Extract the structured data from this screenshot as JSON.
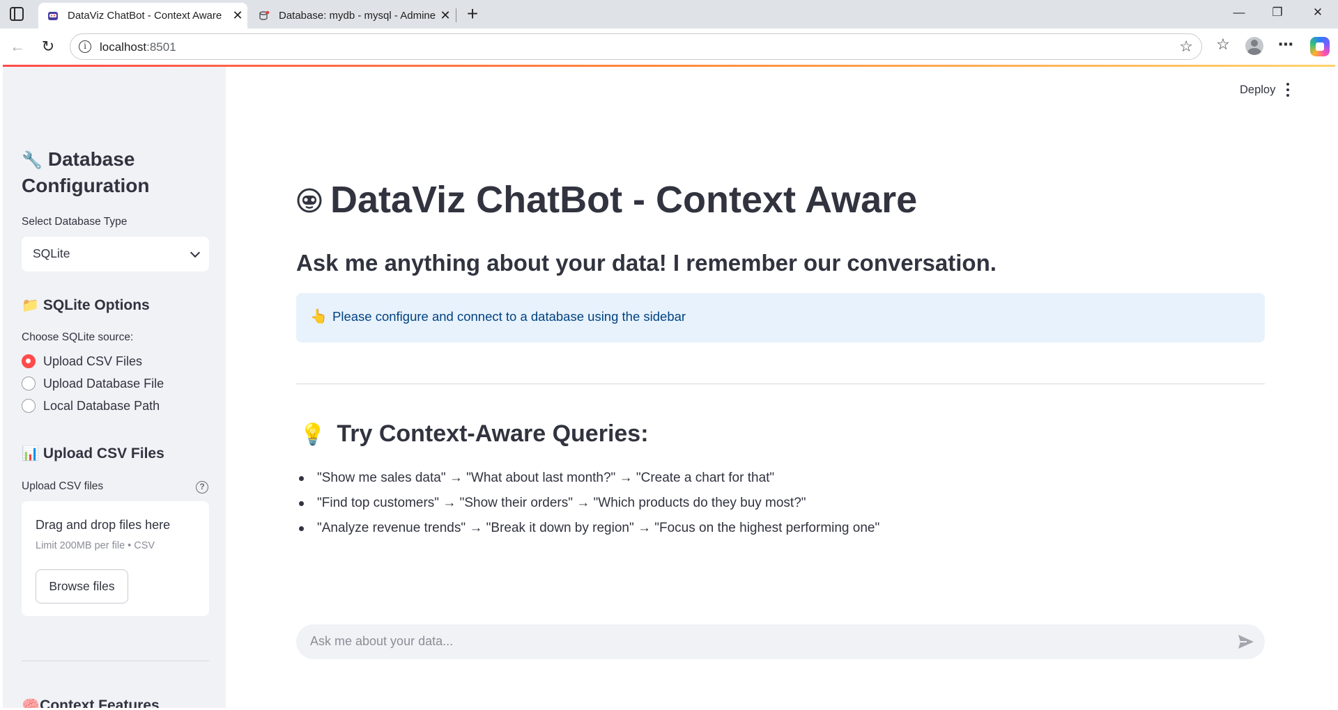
{
  "browser": {
    "tabs": [
      {
        "title": "DataViz ChatBot - Context Aware",
        "active": true
      },
      {
        "title": "Database: mydb - mysql - Adminer",
        "active": false
      }
    ],
    "url_host": "localhost",
    "url_port": ":8501"
  },
  "header": {
    "deploy_label": "Deploy"
  },
  "sidebar": {
    "title": "Database Configuration",
    "title_icon": "wrench",
    "db_type_label": "Select Database Type",
    "db_type_value": "SQLite",
    "sqlite_options_heading": "SQLite Options",
    "sqlite_options_icon": "folder",
    "source_label": "Choose SQLite source:",
    "source_options": [
      {
        "label": "Upload CSV Files",
        "checked": true
      },
      {
        "label": "Upload Database File",
        "checked": false
      },
      {
        "label": "Local Database Path",
        "checked": false
      }
    ],
    "upload_heading": "Upload CSV Files",
    "upload_icon": "bar-chart",
    "upload_label": "Upload CSV files",
    "drag_text": "Drag and drop files here",
    "limit_text": "Limit 200MB per file • CSV",
    "browse_label": "Browse files",
    "next_heading": "Context Features"
  },
  "main": {
    "title": "DataViz ChatBot - Context Aware",
    "subtitle": "Ask me anything about your data! I remember our conversation.",
    "info_message": "Please configure and connect to a database using the sidebar",
    "examples_heading": "Try Context-Aware Queries:",
    "examples": [
      "\"Show me sales data\" → \"What about last month?\" → \"Create a chart for that\"",
      "\"Find top customers\" → \"Show their orders\" → \"Which products do they buy most?\"",
      "\"Analyze revenue trends\" → \"Break it down by region\" → \"Focus on the highest performing one\""
    ],
    "chat_placeholder": "Ask me about your data..."
  },
  "colors": {
    "primary": "#ff4b4b",
    "sidebar_bg": "#f0f2f6",
    "info_bg": "#e8f2fc",
    "info_text": "#004280",
    "text": "#31333f"
  }
}
